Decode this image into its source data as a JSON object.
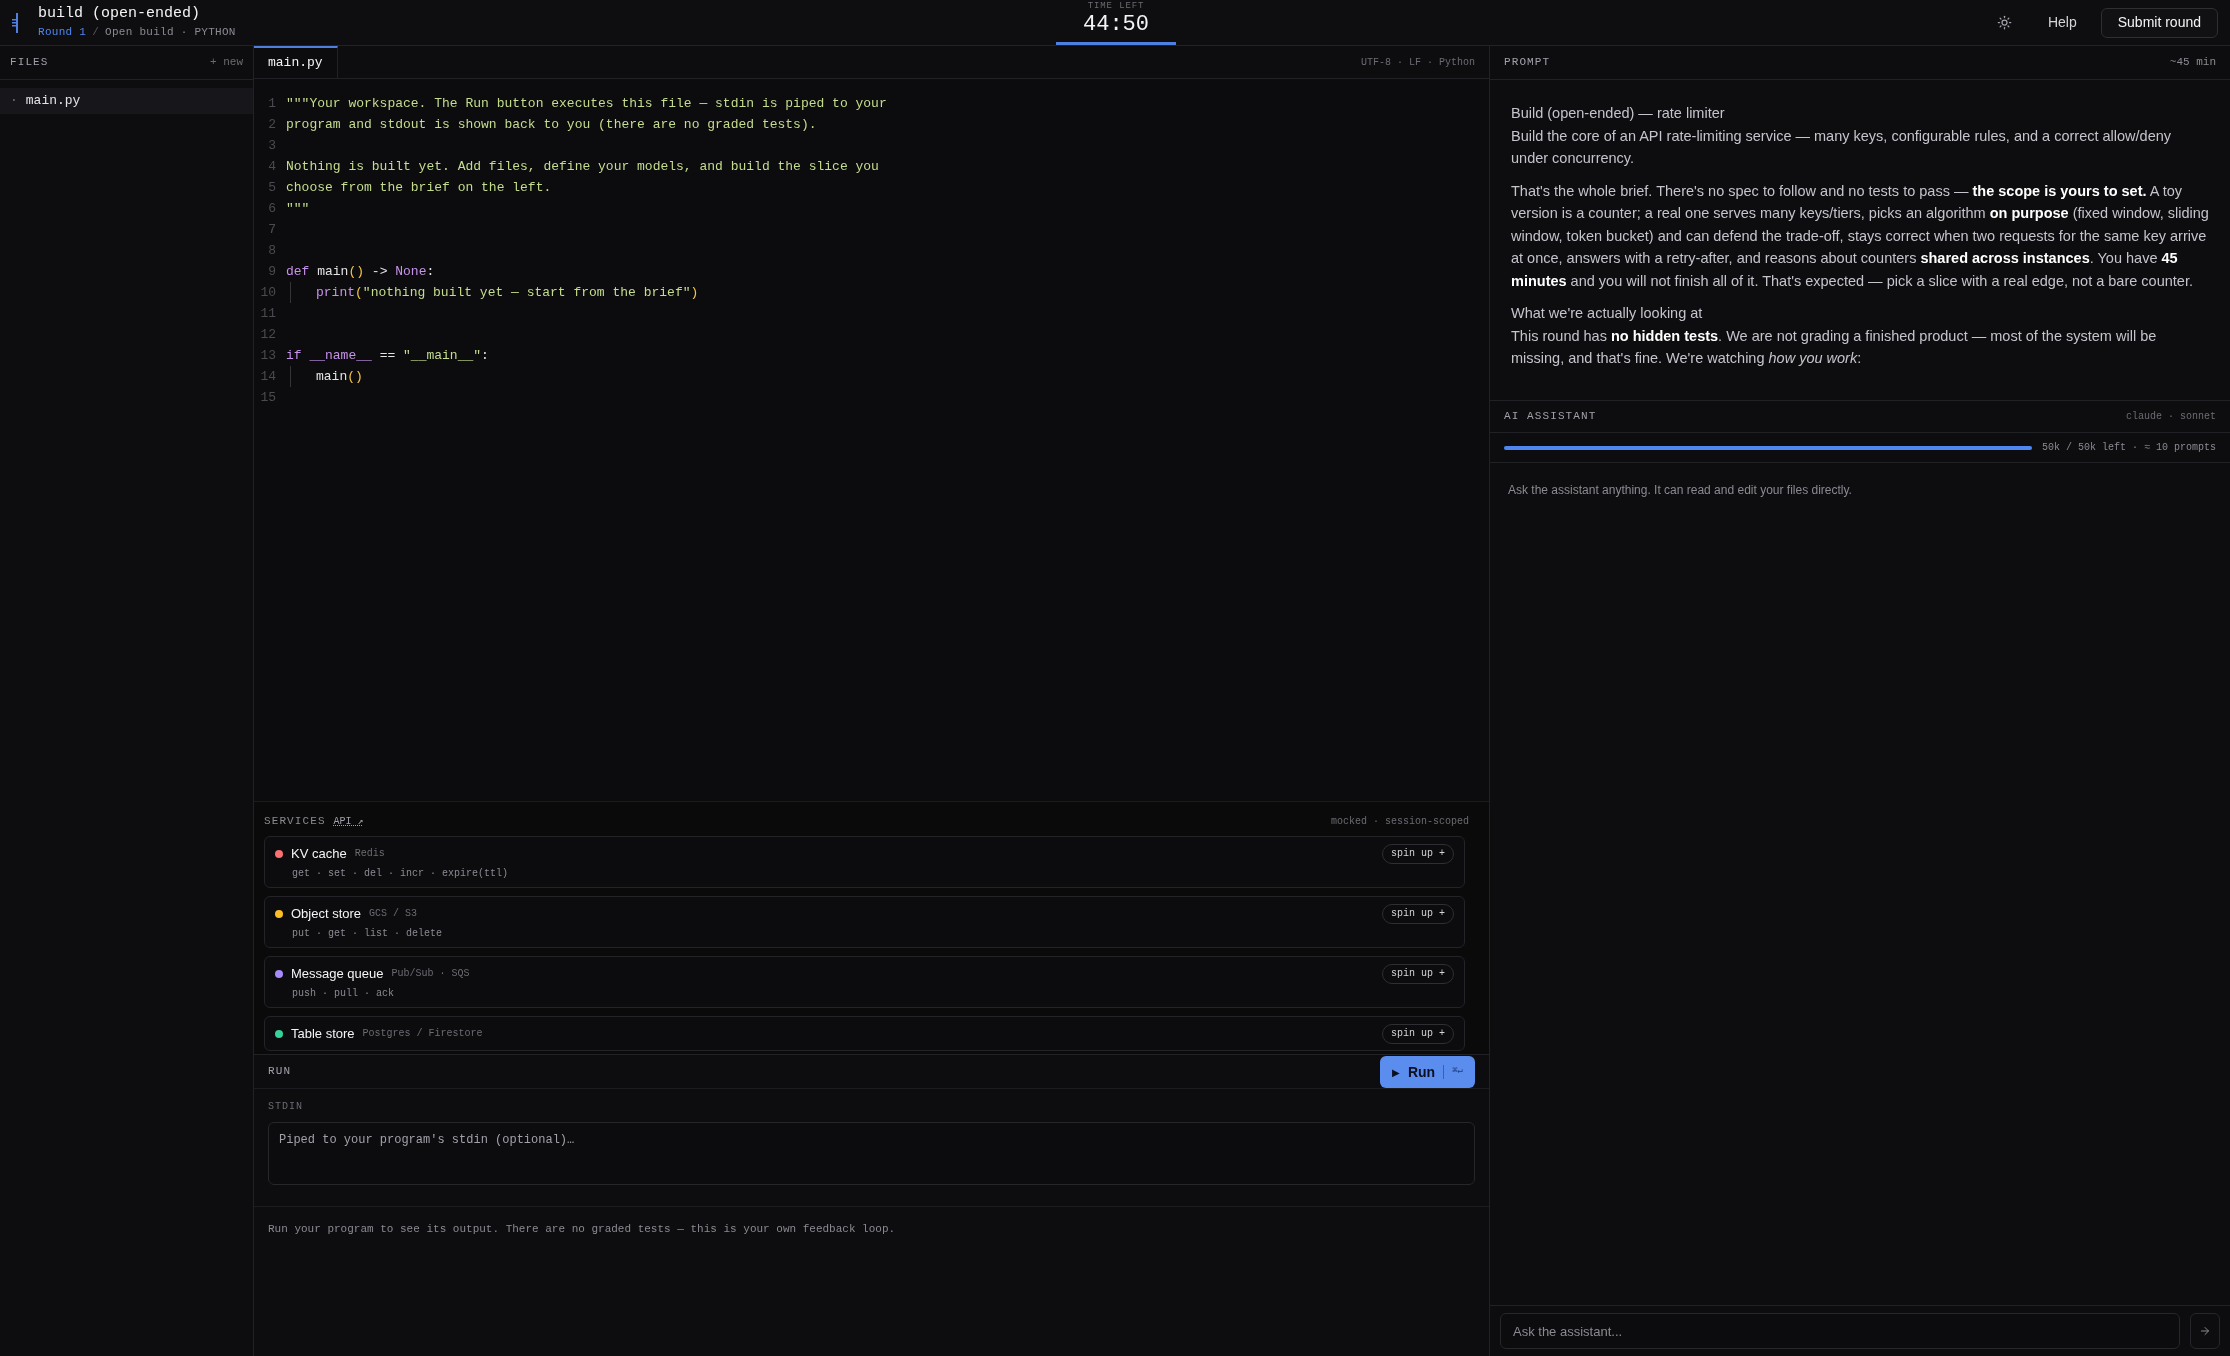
{
  "header": {
    "title": "build (open-ended)",
    "breadcrumb": {
      "round": "Round 1",
      "separator": "/",
      "path": "Open build · PYTHON"
    },
    "timer": {
      "label": "TIME LEFT",
      "value": "44:50"
    },
    "help": "Help",
    "submit": "Submit round"
  },
  "files": {
    "title": "FILES",
    "new": "+ new",
    "items": [
      {
        "bullet": "·",
        "name": "main.py",
        "selected": true
      }
    ]
  },
  "editor": {
    "tabs": [
      {
        "label": "main.py",
        "selected": true
      }
    ],
    "status": "UTF-8 · LF · Python",
    "lines": [
      {
        "number": "1",
        "indented": false,
        "tokens": [
          {
            "kind": "string",
            "text": "\"\"\"Your workspace. The Run button executes this file — stdin is piped to your"
          }
        ]
      },
      {
        "number": "2",
        "indented": false,
        "tokens": [
          {
            "kind": "string",
            "text": "program and stdout is shown back to you (there are no graded tests)."
          }
        ]
      },
      {
        "number": "3",
        "indented": false
      },
      {
        "number": "4",
        "indented": false,
        "tokens": [
          {
            "kind": "string",
            "text": "Nothing is built yet. Add files, define your models, and build the slice you"
          }
        ]
      },
      {
        "number": "5",
        "indented": false,
        "tokens": [
          {
            "kind": "string",
            "text": "choose from the brief on the left."
          }
        ]
      },
      {
        "number": "6",
        "indented": false,
        "tokens": [
          {
            "kind": "string",
            "text": "\"\"\""
          }
        ]
      },
      {
        "number": "7",
        "indented": false
      },
      {
        "number": "8",
        "indented": false
      },
      {
        "number": "9",
        "indented": false,
        "tokens": [
          {
            "kind": "keyword",
            "text": "def"
          },
          {
            "kind": "plain",
            "text": " main"
          },
          {
            "kind": "paren",
            "text": "()"
          },
          {
            "kind": "plain",
            "text": " -> "
          },
          {
            "kind": "keyword",
            "text": "None"
          },
          {
            "kind": "plain",
            "text": ":"
          }
        ]
      },
      {
        "number": "10",
        "indented": true,
        "tokens": [
          {
            "kind": "keyword",
            "text": "print"
          },
          {
            "kind": "paren",
            "text": "("
          },
          {
            "kind": "string",
            "text": "\"nothing built yet — start from the brief\""
          },
          {
            "kind": "paren",
            "text": ")"
          }
        ]
      },
      {
        "number": "11",
        "indented": false
      },
      {
        "number": "12",
        "indented": false
      },
      {
        "number": "13",
        "indented": false,
        "tokens": [
          {
            "kind": "keyword",
            "text": "if"
          },
          {
            "kind": "keyword",
            "text": " __name__"
          },
          {
            "kind": "plain",
            "text": " == "
          },
          {
            "kind": "string",
            "text": "\"__main__\""
          },
          {
            "kind": "plain",
            "text": ":"
          }
        ]
      },
      {
        "number": "14",
        "indented": true,
        "tokens": [
          {
            "kind": "plain",
            "text": "main"
          },
          {
            "kind": "paren",
            "text": "()"
          }
        ]
      },
      {
        "number": "15",
        "indented": false
      }
    ]
  },
  "services": {
    "title": "SERVICES",
    "api_link": "API ↗",
    "note": "mocked · session-scoped",
    "items": [
      {
        "name": "KV cache",
        "tech": "Redis",
        "ops": "get · set · del · incr · expire(ttl)",
        "button": "spin up +",
        "color": "#f87171"
      },
      {
        "name": "Object store",
        "tech": "GCS / S3",
        "ops": "put · get · list · delete",
        "button": "spin up +",
        "color": "#fbbf24"
      },
      {
        "name": "Message queue",
        "tech": "Pub/Sub · SQS",
        "ops": "push · pull · ack",
        "button": "spin up +",
        "color": "#a78bfa"
      },
      {
        "name": "Table store",
        "tech": "Postgres / Firestore",
        "button": "spin up +",
        "color": "#34d399"
      }
    ]
  },
  "run": {
    "title": "RUN",
    "button": {
      "icon": "▶",
      "label": "Run",
      "shortcut": "⌘↵"
    },
    "stdin_label": "STDIN",
    "stdin_placeholder": "Piped to your program's stdin (optional)…",
    "output": "Run your program to see its output. There are no graded tests — this is your own feedback loop."
  },
  "prompt": {
    "title": "PROMPT",
    "duration": "~45 min",
    "paragraphs": [
      {
        "heading": "Build (open-ended) — rate limiter",
        "text": "Build the core of an API rate-limiting service — many keys, configurable rules, and a correct allow/deny under concurrency."
      },
      {
        "text": "That's the whole brief. There's no spec to follow and no tests to pass — **the scope is yours to set.** A toy version is a counter; a real one serves many keys/tiers, picks an algorithm **on purpose** (fixed window, sliding window, token bucket) and can defend the trade-off, stays correct when two requests for the same key arrive at once, answers with a retry-after, and reasons about counters **shared across instances**. You have **45 minutes** and you will not finish all of it. That's expected — pick a slice with a real edge, not a bare counter."
      },
      {
        "heading": "What we're actually looking at",
        "text": "This round has **no hidden tests**. We are not grading a finished product — most of the system will be missing, and that's fine. We're watching *how you work*:"
      }
    ]
  },
  "assistant": {
    "title": "AI ASSISTANT",
    "model": "claude · sonnet",
    "budget": {
      "level": 1,
      "reading": "50k / 50k left · ≈ 10 prompts"
    },
    "hint": "Ask the assistant anything. It can read and edit your files directly.",
    "input_placeholder": "Ask the assistant..."
  }
}
